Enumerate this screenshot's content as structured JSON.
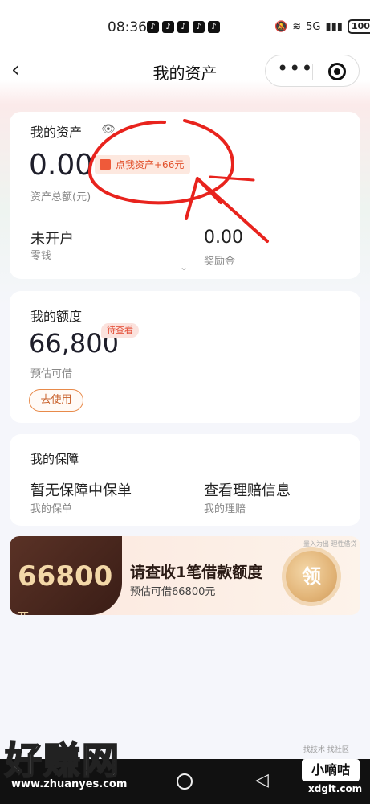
{
  "status_bar": {
    "time": "08:36",
    "app_icons": [
      "tiktok-icon",
      "tiktok-icon",
      "tiktok-icon",
      "tiktok-icon",
      "tiktok-icon"
    ],
    "signal": "5G",
    "battery": "100"
  },
  "nav": {
    "title": "我的资产",
    "more": "•••"
  },
  "assets": {
    "title": "我的资产",
    "amount": "0.00",
    "promo": "点我资产+66元",
    "amount_label": "资产总额(元)",
    "change_title": "未开户",
    "change_label": "零钱",
    "bonus_value": "0.00",
    "bonus_label": "奖励金"
  },
  "quota": {
    "title": "我的额度",
    "amount": "66,800",
    "badge": "待查看",
    "label": "预估可借",
    "button": "去使用"
  },
  "guard": {
    "title": "我的保障",
    "left_title": "暂无保障中保单",
    "left_label": "我的保单",
    "right_title": "查看理赔信息",
    "right_label": "我的理赔"
  },
  "banner": {
    "amount": "66800",
    "unit": "元",
    "headline": "请查收1笔借款额度",
    "subline": "预估可借66800元",
    "tiny": "量入为出 理性借贷",
    "seal": "领"
  },
  "watermark": {
    "site_name": "好赚网",
    "site_url": "www.zhuanyes.com",
    "brand": "小嘀咕",
    "brand_url": "xdglt.com",
    "faint_text": "找技术 找社区"
  },
  "colors": {
    "accent_red": "#e2452d",
    "annotation_red": "#e8231d",
    "banner_dark": "#3a1d16"
  }
}
